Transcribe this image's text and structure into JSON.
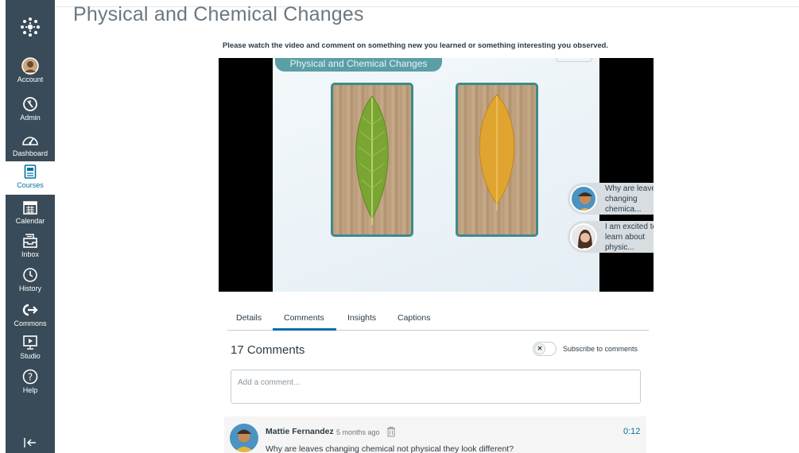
{
  "app": {
    "brand_color": "#394b58",
    "accent_color": "#0770a3"
  },
  "nav": {
    "logo_icon": "canvas-logo-icon",
    "items": [
      {
        "label": "Account",
        "icon": "account-avatar-icon"
      },
      {
        "label": "Admin",
        "icon": "shield-icon"
      },
      {
        "label": "Dashboard",
        "icon": "dashboard-icon"
      },
      {
        "label": "Courses",
        "icon": "book-icon",
        "active": true
      },
      {
        "label": "Calendar",
        "icon": "calendar-icon"
      },
      {
        "label": "Inbox",
        "icon": "inbox-icon"
      },
      {
        "label": "History",
        "icon": "clock-icon"
      },
      {
        "label": "Commons",
        "icon": "commons-icon"
      },
      {
        "label": "Studio",
        "icon": "studio-icon"
      },
      {
        "label": "Help",
        "icon": "help-icon"
      }
    ],
    "collapse_icon": "collapse-nav-icon"
  },
  "page": {
    "title": "Physical and Chemical Changes",
    "instructions": "Please watch the video and comment on something new you learned or something interesting you observed."
  },
  "video": {
    "slide_title": "Physical and Chemical Changes",
    "bubbles": [
      {
        "text": "Why are leaves changing chemica..."
      },
      {
        "text": "I am excited to learn about physic..."
      }
    ]
  },
  "tabs": [
    {
      "label": "Details"
    },
    {
      "label": "Comments",
      "active": true
    },
    {
      "label": "Insights"
    },
    {
      "label": "Captions"
    }
  ],
  "comments": {
    "count_label": "17 Comments",
    "subscribe_label": "Subscribe to comments",
    "input_placeholder": "Add a comment...",
    "items": [
      {
        "author": "Mattie Fernandez",
        "time": "5 months ago",
        "timestamp": "0:12",
        "text": "Why are leaves changing chemical not physical they look different?"
      }
    ]
  }
}
